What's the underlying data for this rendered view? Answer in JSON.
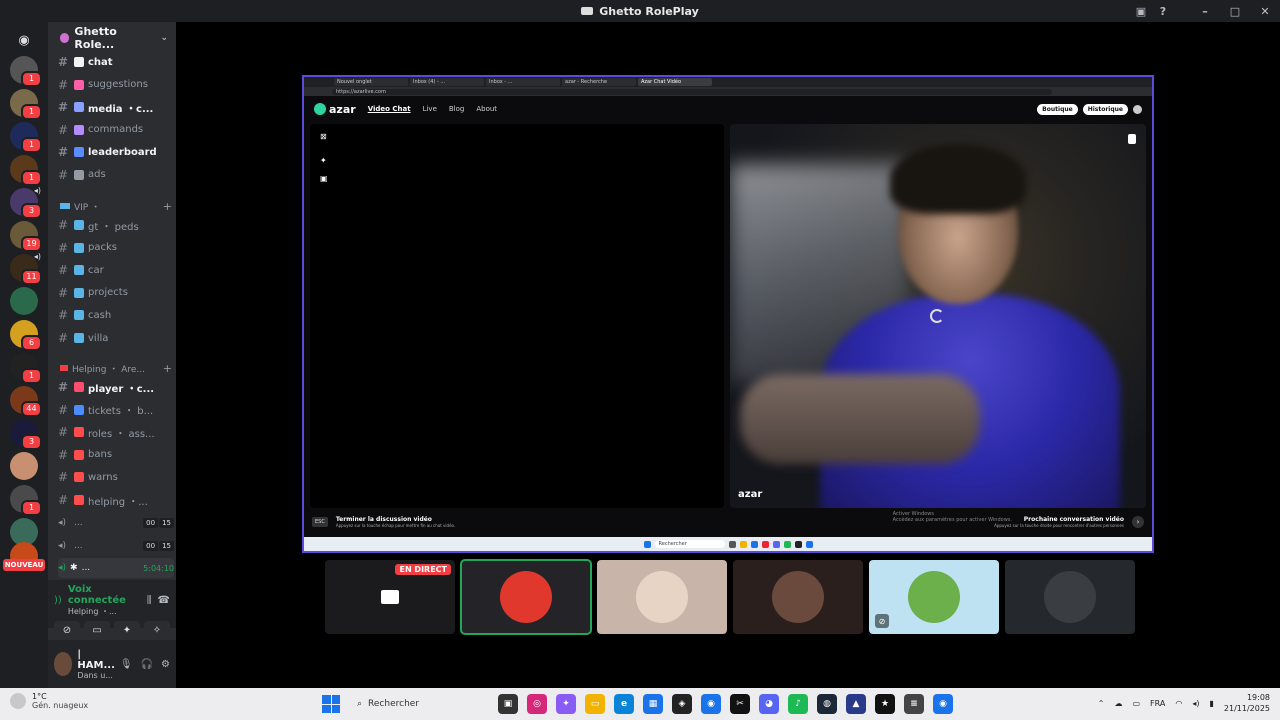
{
  "window": {
    "title": "Ghetto RolePlay"
  },
  "server": {
    "name": "Ghetto Role..."
  },
  "channels": [
    {
      "label": "chat",
      "bold": true,
      "color": "#f2f3f5"
    },
    {
      "label": "suggestions",
      "bold": false,
      "color": "#ff5fa8"
    },
    {
      "label": "media ・c...",
      "bold": true,
      "color": "#8aa0ff"
    },
    {
      "label": "commands",
      "bold": false,
      "color": "#b58cff"
    },
    {
      "label": "leaderboard",
      "bold": true,
      "color": "#5a8cff"
    },
    {
      "label": "ads",
      "bold": false,
      "color": "#949ba4"
    }
  ],
  "vip_category": {
    "label": "VIP ・"
  },
  "vip_channels": [
    {
      "label": "gt ・ peds",
      "color": "#5ab4e6"
    },
    {
      "label": "packs",
      "color": "#5ab4e6"
    },
    {
      "label": "car",
      "color": "#5ab4e6"
    },
    {
      "label": "projects",
      "color": "#5ab4e6"
    },
    {
      "label": "cash",
      "color": "#5ab4e6"
    },
    {
      "label": "villa",
      "color": "#5ab4e6"
    }
  ],
  "helping_category": {
    "label": "Helping ・ Are..."
  },
  "helping_channels": [
    {
      "label": "player ・c...",
      "bold": true,
      "color": "#ff4d6d"
    },
    {
      "label": "tickets ・ b...",
      "bold": false,
      "color": "#4d8cff"
    },
    {
      "label": "roles ・ ass...",
      "bold": false,
      "color": "#ff4d4d"
    },
    {
      "label": "bans",
      "bold": false,
      "color": "#ff4d4d"
    },
    {
      "label": "warns",
      "bold": false,
      "color": "#ff4d4d"
    },
    {
      "label": "helping ・...",
      "bold": false,
      "color": "#ff4d4d"
    }
  ],
  "voice_channels": [
    {
      "label": "...",
      "a": "00",
      "b": "15"
    },
    {
      "label": "...",
      "a": "00",
      "b": "15"
    }
  ],
  "active_voice": {
    "label": "...",
    "timer": "5:04:10"
  },
  "guild_badges": [
    "1",
    "1",
    "1",
    "1",
    "3",
    "19",
    "11",
    "6",
    "1",
    "44",
    "3",
    "1",
    "1"
  ],
  "nouveau_label": "NOUVEAU",
  "voice_panel": {
    "status": "Voix connectée",
    "sub": "Helping ・..."
  },
  "user_panel": {
    "name": "| HAM...",
    "status": "Dans u..."
  },
  "browser": {
    "tabs": [
      "Nouvel onglet",
      "Inbox (4) - ...",
      "Inbox - ...",
      "azar - Recherche",
      "Azar Chat Vidéo"
    ],
    "url": "https://azarlive.com"
  },
  "azar": {
    "logo": "azar",
    "nav": [
      "Video Chat",
      "Live",
      "Blog",
      "About"
    ],
    "shop": "Boutique",
    "history": "Historique",
    "watermark": "azar",
    "esc": "ESC",
    "end_title": "Terminer la discussion vidéo",
    "end_sub": "Appuyez sur la touche échap pour mettre fin au chat vidéo.",
    "next_title": "Prochaine conversation vidéo",
    "next_sub": "Appuyez sur la touche droite pour rencontrer d'autres personnes",
    "activate_title": "Activer Windows",
    "activate_sub": "Accédez aux paramètres pour activer Windows.",
    "inner_search": "Rechercher"
  },
  "tiles": [
    {
      "type": "stream",
      "live_label": "EN DIRECT",
      "bg": "#1b1b1e"
    },
    {
      "type": "avatar",
      "speaking": true,
      "bg": "#242428",
      "avatar": "#e0382c"
    },
    {
      "type": "avatar",
      "speaking": false,
      "bg": "#c8b4a8",
      "avatar": "#e8d4c4"
    },
    {
      "type": "avatar",
      "speaking": false,
      "bg": "#2a1f1c",
      "avatar": "#6a4a3c"
    },
    {
      "type": "avatar",
      "speaking": false,
      "bg": "#bfe2f2",
      "avatar": "#6bb04a"
    },
    {
      "type": "avatar",
      "speaking": false,
      "bg": "#25282c",
      "avatar": "#3a3d42"
    }
  ],
  "taskbar": {
    "temp": "1°C",
    "weather": "Gén. nuageux",
    "search": "Rechercher",
    "lang": "FRA",
    "time": "19:08",
    "date": "21/11/2025"
  },
  "colors": {
    "accent": "#5b4bd6",
    "green": "#23a55a",
    "red": "#f23f43"
  }
}
